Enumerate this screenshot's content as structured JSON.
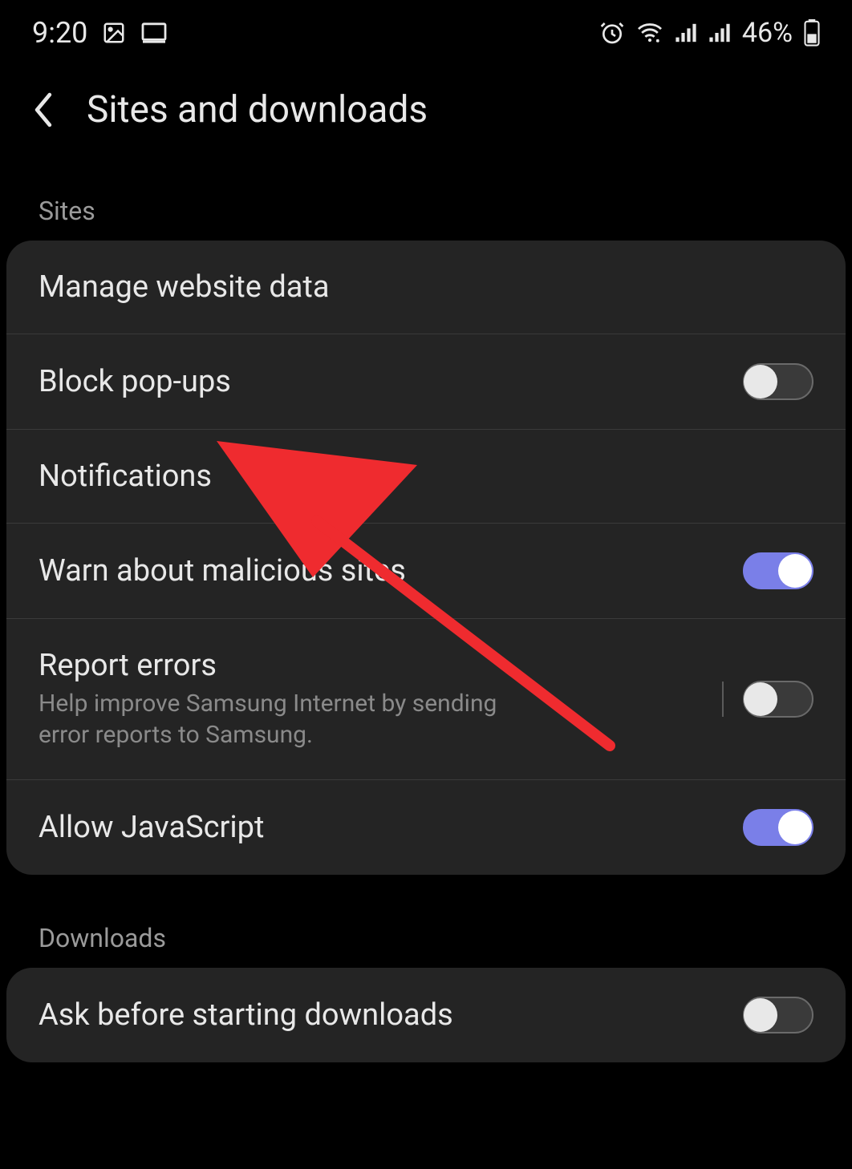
{
  "status_bar": {
    "time": "9:20",
    "battery": "46%"
  },
  "header": {
    "title": "Sites and downloads"
  },
  "sections": {
    "sites": {
      "label": "Sites",
      "items": {
        "manage_website_data": {
          "title": "Manage website data"
        },
        "block_popups": {
          "title": "Block pop-ups",
          "toggle": false
        },
        "notifications": {
          "title": "Notifications"
        },
        "warn_malicious": {
          "title": "Warn about malicious sites",
          "toggle": true
        },
        "report_errors": {
          "title": "Report errors",
          "subtitle": "Help improve Samsung Internet by sending error reports to Samsung.",
          "toggle": false
        },
        "allow_javascript": {
          "title": "Allow JavaScript",
          "toggle": true
        }
      }
    },
    "downloads": {
      "label": "Downloads",
      "items": {
        "ask_before_downloads": {
          "title": "Ask before starting downloads",
          "toggle": false
        }
      }
    }
  }
}
